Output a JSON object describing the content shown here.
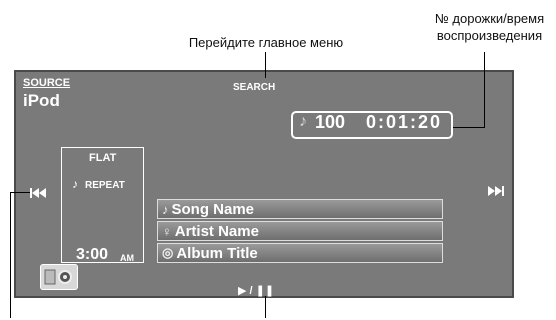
{
  "annotations": {
    "main_menu": "Перейдите главное меню",
    "track_time_line1": "№ дорожки/время",
    "track_time_line2": "воспроизведения"
  },
  "screen": {
    "source_label": "SOURCE",
    "source_value": "iPod",
    "search_label": "SEARCH",
    "track_number": "100",
    "playing_time": "0:01:20",
    "sound_mode": "FLAT",
    "repeat_label": "REPEAT",
    "clock_time": "3:00",
    "clock_ampm": "AM",
    "prev_symbol": "▶|◀◀",
    "next_symbol": "▶▶|",
    "playpause_symbol": "▶ / ❚❚",
    "list": [
      {
        "icon": "♪",
        "label": "Song Name"
      },
      {
        "icon": "♀",
        "label": "Artist Name"
      },
      {
        "icon": "◎",
        "label": "Album Title"
      }
    ]
  },
  "colors": {
    "screen_bg": "#7a7a7a",
    "screen_border": "#4a4a4a",
    "text": "#ffffff"
  }
}
